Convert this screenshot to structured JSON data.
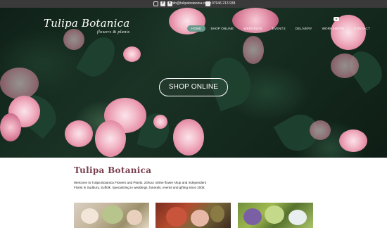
{
  "topbar": {
    "social_icons": [
      "instagram-icon",
      "facebook-icon",
      "twitter-icon"
    ],
    "email": "info@tulipabotanica.co.uk",
    "phone_icon": "phone-icon",
    "phone": "07946 213 938"
  },
  "brand": {
    "title": "Tulipa Botanica",
    "subtitle": "flowers & plants"
  },
  "nav": {
    "items": [
      {
        "label": "HOME",
        "active": true
      },
      {
        "label": "SHOP ONLINE",
        "active": false
      },
      {
        "label": "WEDDINGS",
        "active": false
      },
      {
        "label": "EVENTS",
        "active": false
      },
      {
        "label": "DELIVERY",
        "active": false
      },
      {
        "label": "WORKSHOPS",
        "active": false
      },
      {
        "label": "CONTACT",
        "active": false
      }
    ],
    "youtube_icon": "youtube-icon"
  },
  "hero": {
    "cta_label": "SHOP ONLINE"
  },
  "content": {
    "title": "Tulipa Botanica",
    "intro": "Welcome to Tulipa Botanica Flowers and Plants, 24hour online flower shop and Independent Florist in Sudbury, Suffolk. Specializing in weddings, funerals, events and gifting since 2008."
  },
  "colors": {
    "topbar": "#3a3a3a",
    "nav_active": "#6d9a8e",
    "heading": "#7a3f4e"
  }
}
